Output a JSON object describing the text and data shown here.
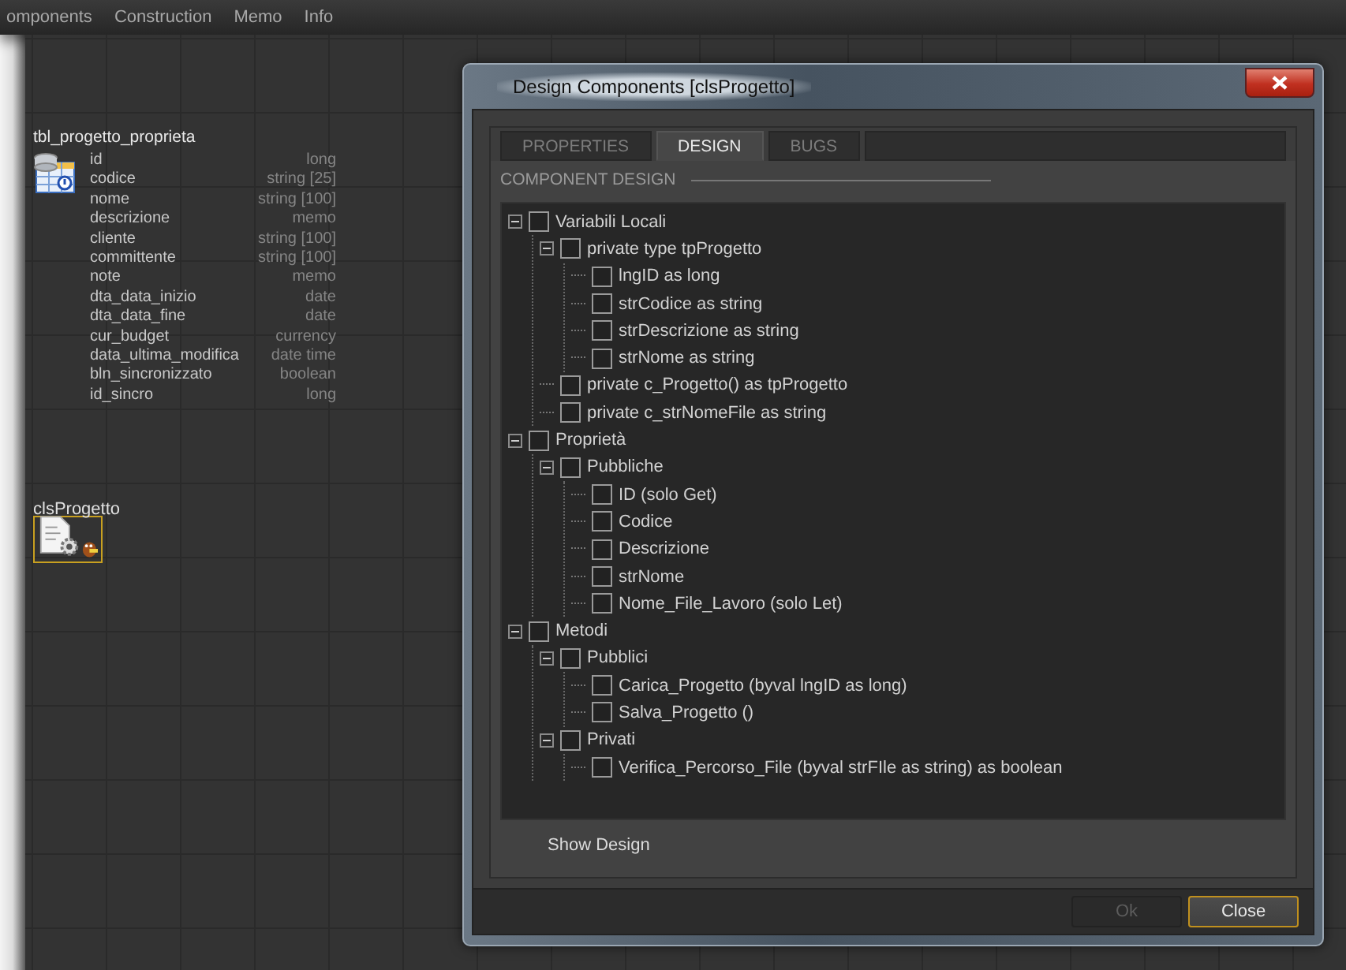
{
  "menu": [
    "omponents",
    "Construction",
    "Memo",
    "Info"
  ],
  "canvas": {
    "table": {
      "title": "tbl_progetto_proprieta",
      "fields": [
        {
          "name": "id",
          "type": "long"
        },
        {
          "name": "codice",
          "type": "string [25]"
        },
        {
          "name": "nome",
          "type": "string [100]"
        },
        {
          "name": "descrizione",
          "type": "memo"
        },
        {
          "name": "cliente",
          "type": "string [100]"
        },
        {
          "name": "committente",
          "type": "string [100]"
        },
        {
          "name": "note",
          "type": "memo"
        },
        {
          "name": "dta_data_inizio",
          "type": "date"
        },
        {
          "name": "dta_data_fine",
          "type": "date"
        },
        {
          "name": "cur_budget",
          "type": "currency"
        },
        {
          "name": "data_ultima_modifica",
          "type": "date time"
        },
        {
          "name": "bln_sincronizzato",
          "type": "boolean"
        },
        {
          "name": "id_sincro",
          "type": "long"
        }
      ]
    },
    "class_node": {
      "title": "clsProgetto",
      "selected": true
    }
  },
  "dialog": {
    "title": "Design Components  [clsProgetto]",
    "tabs": [
      {
        "label": "PROPERTIES",
        "selected": false
      },
      {
        "label": "DESIGN",
        "selected": true
      },
      {
        "label": "BUGS",
        "selected": false
      }
    ],
    "section_title": "COMPONENT DESIGN",
    "tree": [
      {
        "label": "Variabili Locali",
        "checked": false,
        "expanded": true,
        "children": [
          {
            "label": "private type tpProgetto",
            "checked": false,
            "expanded": true,
            "children": [
              {
                "label": "lngID as long",
                "checked": false
              },
              {
                "label": "strCodice as string",
                "checked": false
              },
              {
                "label": "strDescrizione as string",
                "checked": false
              },
              {
                "label": "strNome as string",
                "checked": false
              }
            ]
          },
          {
            "label": "private c_Progetto() as tpProgetto",
            "checked": false
          },
          {
            "label": "private c_strNomeFile as string",
            "checked": false
          }
        ]
      },
      {
        "label": "Proprietà",
        "checked": false,
        "expanded": true,
        "children": [
          {
            "label": "Pubbliche",
            "checked": false,
            "expanded": true,
            "children": [
              {
                "label": "ID  (solo Get)",
                "checked": false
              },
              {
                "label": "Codice",
                "checked": false
              },
              {
                "label": "Descrizione",
                "checked": false
              },
              {
                "label": "strNome",
                "checked": false
              },
              {
                "label": "Nome_File_Lavoro (solo Let)",
                "checked": false
              }
            ]
          }
        ]
      },
      {
        "label": "Metodi",
        "checked": false,
        "expanded": true,
        "children": [
          {
            "label": "Pubblici",
            "checked": false,
            "expanded": true,
            "children": [
              {
                "label": "Carica_Progetto (byval lngID as long)",
                "checked": false
              },
              {
                "label": "Salva_Progetto ()",
                "checked": false
              }
            ]
          },
          {
            "label": "Privati",
            "checked": false,
            "expanded": true,
            "children": [
              {
                "label": "Verifica_Percorso_File (byval strFIle as string) as boolean",
                "checked": false
              }
            ]
          }
        ]
      }
    ],
    "show_design": "Show Design",
    "buttons": [
      {
        "label": "Ok",
        "disabled": true,
        "selected": false
      },
      {
        "label": "Close",
        "disabled": false,
        "selected": true
      }
    ]
  }
}
